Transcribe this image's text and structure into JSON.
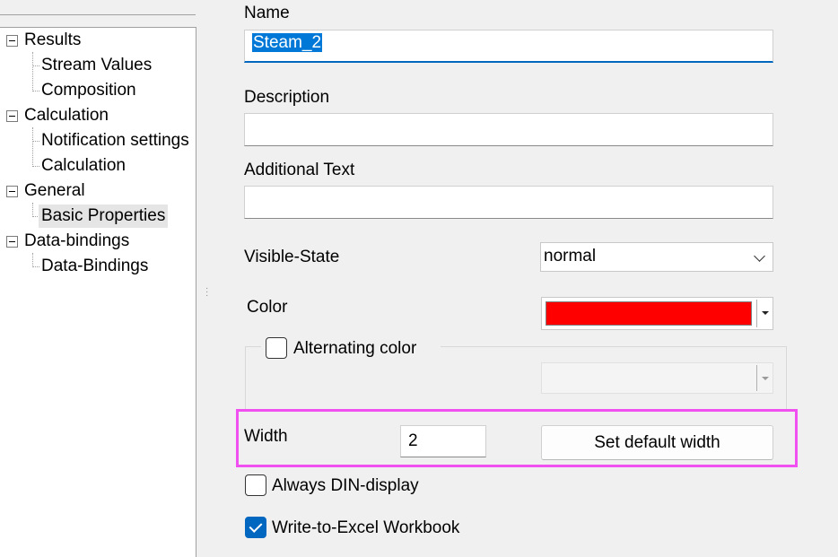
{
  "tree": {
    "items": [
      {
        "label": "Results",
        "level": 0
      },
      {
        "label": "Stream Values",
        "level": 1
      },
      {
        "label": "Composition",
        "level": 1
      },
      {
        "label": "Calculation",
        "level": 0
      },
      {
        "label": "Notification settings",
        "level": 1
      },
      {
        "label": "Calculation",
        "level": 1
      },
      {
        "label": "General",
        "level": 0
      },
      {
        "label": "Basic Properties",
        "level": 1,
        "selected": true
      },
      {
        "label": "Data-bindings",
        "level": 0
      },
      {
        "label": "Data-Bindings",
        "level": 1
      }
    ]
  },
  "form": {
    "name": {
      "label": "Name",
      "value": "Steam_2"
    },
    "description": {
      "label": "Description",
      "value": ""
    },
    "additional_text": {
      "label": "Additional Text",
      "value": ""
    },
    "visible_state": {
      "label": "Visible-State",
      "value": "normal"
    },
    "color": {
      "label": "Color",
      "value": "#ff0000"
    },
    "alternating_color": {
      "label": "Alternating color",
      "checked": false
    },
    "width": {
      "label": "Width",
      "value": "2"
    },
    "set_default_width": {
      "label": "Set default width"
    },
    "always_din": {
      "label": "Always DIN-display",
      "checked": false
    },
    "write_to_excel": {
      "label": "Write-to-Excel Workbook",
      "checked": true
    }
  },
  "colors": {
    "selection_blue": "#0078d7",
    "highlight_magenta": "#f050f0",
    "checkbox_checked": "#0067c0"
  },
  "icons": [
    "collapse-icon",
    "chevron-down-icon",
    "dropdown-arrow-icon",
    "checkmark-icon",
    "splitter-grip-icon"
  ]
}
